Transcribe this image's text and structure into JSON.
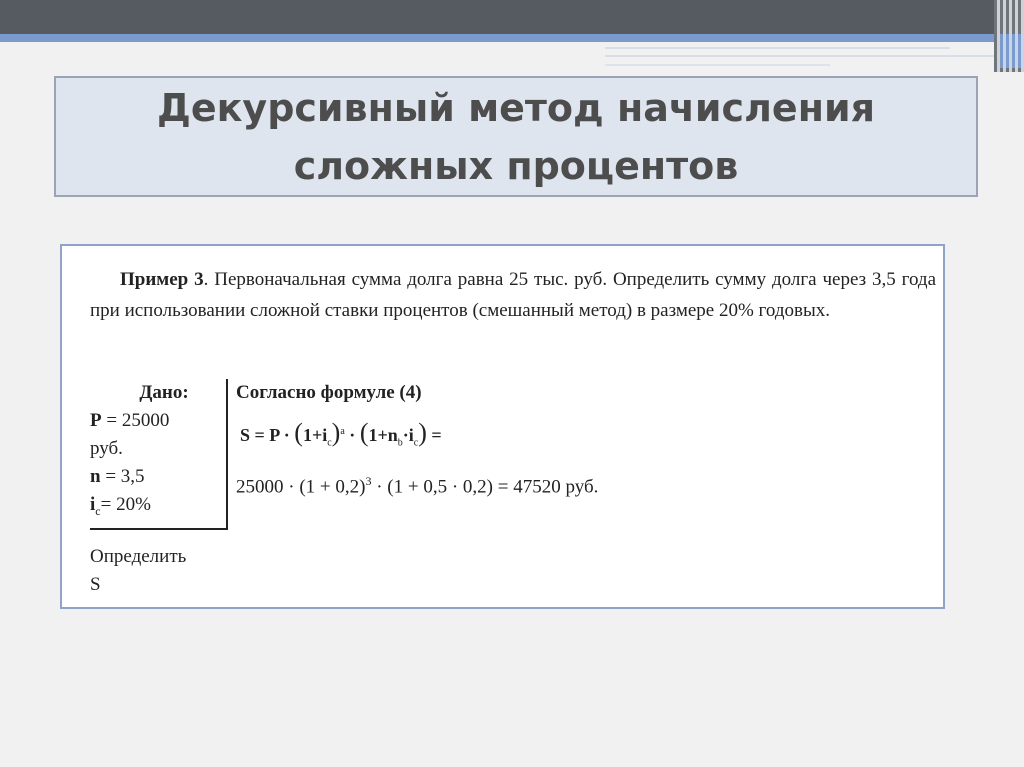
{
  "slide": {
    "title_line1": "Декурсивный метод начисления",
    "title_line2": "сложных процентов"
  },
  "example": {
    "label": "Пример 3",
    "text": ". Первоначальная сумма долга равна 25 тыс. руб. Определить сумму долга через 3,5 года при использовании сложной ставки процентов (смешанный метод) в размере 20% годовых."
  },
  "given": {
    "title": "Дано:",
    "p_sym": "P",
    "p_val": " = 25000",
    "p_unit": "руб.",
    "n_sym": "n",
    "n_val": " = 3,5",
    "i_sym": "i",
    "i_sub": "c",
    "i_val": "= 20%"
  },
  "find": {
    "label": "Определить",
    "var": "S"
  },
  "solution": {
    "title": "Согласно формуле (4)",
    "formula_left": "S = P ·",
    "formula_one1": "1+i",
    "formula_sub_c1": "c",
    "formula_sup_a": "a",
    "formula_dot": "·",
    "formula_one2": "1+n",
    "formula_sub_b": "b",
    "formula_i2": "·i",
    "formula_sub_c2": "c",
    "formula_eq": "=",
    "calc_part1": "25000 · (1 + 0,2)",
    "calc_sup": "3",
    "calc_part2": " · (1 + 0,5 · 0,2) = 47520 руб."
  }
}
